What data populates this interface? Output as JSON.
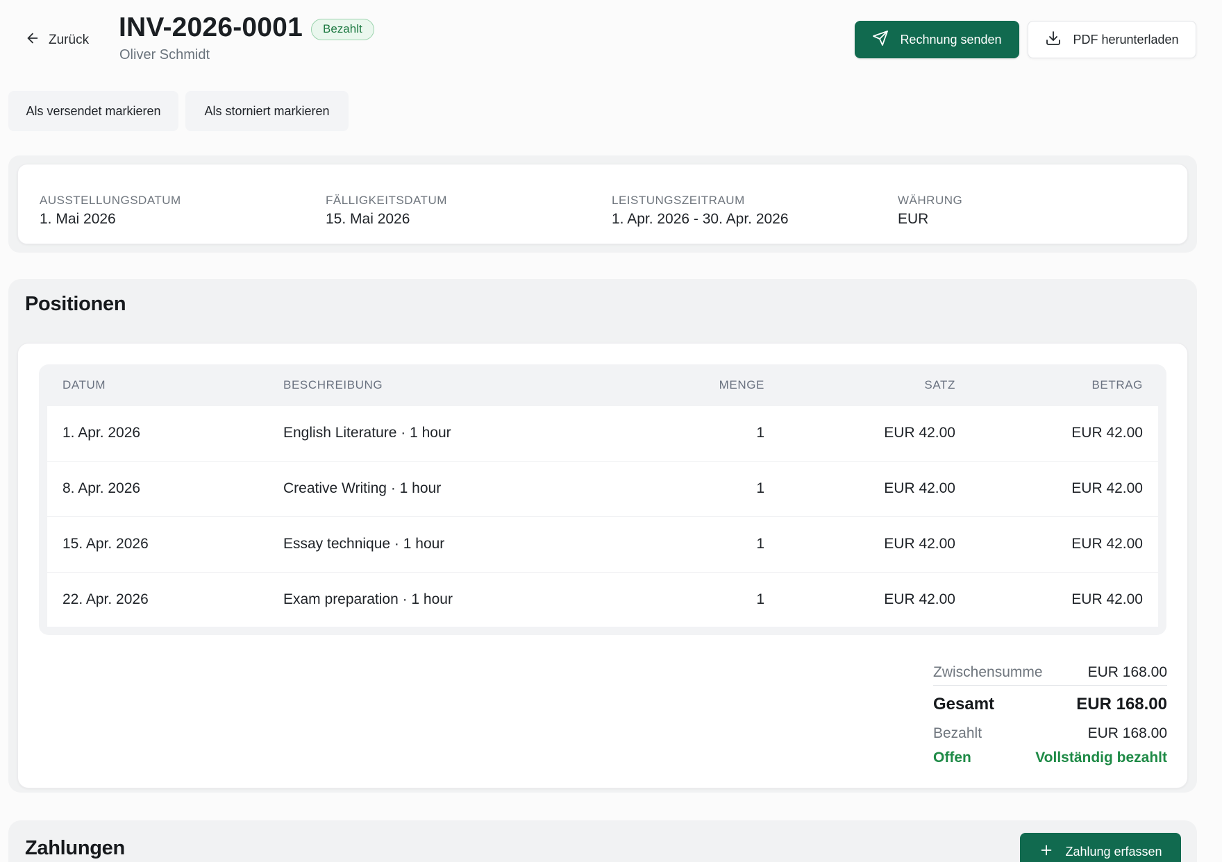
{
  "header": {
    "back_label": "Zurück",
    "invoice_number": "INV-2026-0001",
    "status_badge": "Bezahlt",
    "customer_name": "Oliver Schmidt",
    "send_button": "Rechnung senden",
    "download_button": "PDF herunterladen"
  },
  "actions": {
    "mark_sent": "Als versendet markieren",
    "mark_cancelled": "Als storniert markieren"
  },
  "meta": [
    {
      "label": "AUSSTELLUNGSDATUM",
      "value": "1. Mai 2026"
    },
    {
      "label": "FÄLLIGKEITSDATUM",
      "value": "15. Mai 2026"
    },
    {
      "label": "LEISTUNGSZEITRAUM",
      "value": "1. Apr. 2026 - 30. Apr. 2026"
    },
    {
      "label": "WÄHRUNG",
      "value": "EUR"
    }
  ],
  "positions": {
    "title": "Positionen",
    "columns": {
      "date": "DATUM",
      "description": "BESCHREIBUNG",
      "quantity": "MENGE",
      "rate": "SATZ",
      "amount": "BETRAG"
    },
    "rows": [
      {
        "date": "1. Apr. 2026",
        "description": "English Literature · 1 hour",
        "quantity": "1",
        "rate": "EUR 42.00",
        "amount": "EUR 42.00"
      },
      {
        "date": "8. Apr. 2026",
        "description": "Creative Writing · 1 hour",
        "quantity": "1",
        "rate": "EUR 42.00",
        "amount": "EUR 42.00"
      },
      {
        "date": "15. Apr. 2026",
        "description": "Essay technique · 1 hour",
        "quantity": "1",
        "rate": "EUR 42.00",
        "amount": "EUR 42.00"
      },
      {
        "date": "22. Apr. 2026",
        "description": "Exam preparation · 1 hour",
        "quantity": "1",
        "rate": "EUR 42.00",
        "amount": "EUR 42.00"
      }
    ]
  },
  "totals": {
    "subtotal_label": "Zwischensumme",
    "subtotal_value": "EUR 168.00",
    "total_label": "Gesamt",
    "total_value": "EUR 168.00",
    "paid_label": "Bezahlt",
    "paid_value": "EUR 168.00",
    "open_label": "Offen",
    "open_value": "Vollständig bezahlt"
  },
  "payments": {
    "title": "Zahlungen",
    "add_button": "Zahlung erfassen"
  },
  "colors": {
    "primary": "#116a4f",
    "paid_badge": "#1f7a43",
    "open_status": "#1e8a46"
  }
}
